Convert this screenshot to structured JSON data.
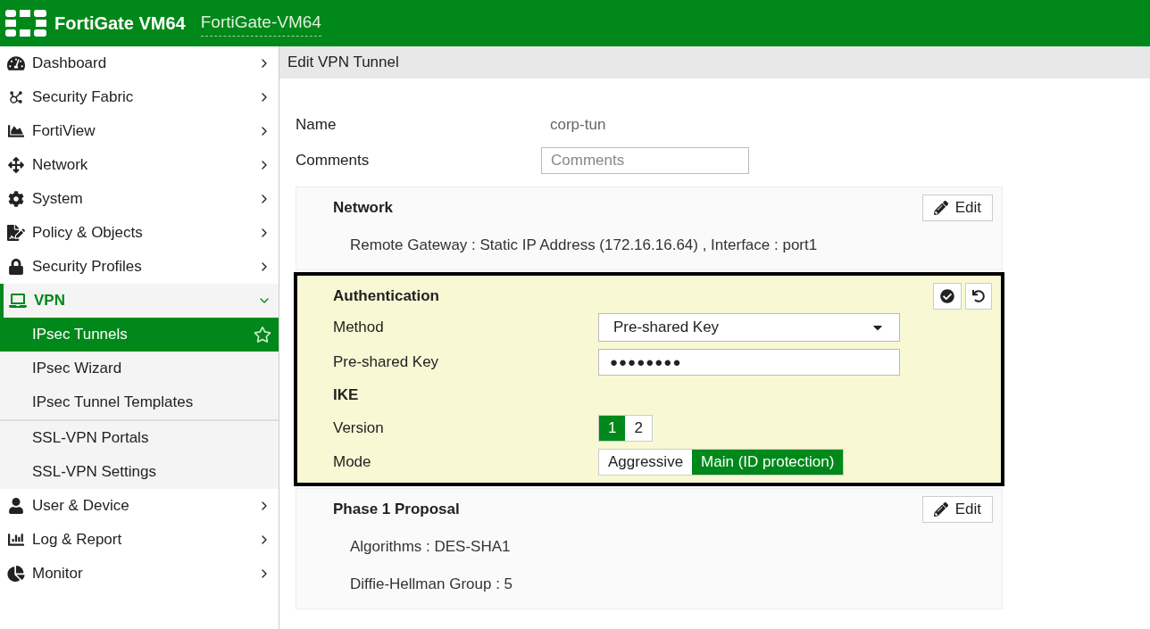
{
  "header": {
    "product": "FortiGate VM64",
    "hostname": "FortiGate-VM64"
  },
  "sidebar": {
    "items": [
      {
        "label": "Dashboard",
        "expanded": false,
        "selected": false
      },
      {
        "label": "Security Fabric",
        "expanded": false,
        "selected": false
      },
      {
        "label": "FortiView",
        "expanded": false,
        "selected": false
      },
      {
        "label": "Network",
        "expanded": false,
        "selected": false
      },
      {
        "label": "System",
        "expanded": false,
        "selected": false
      },
      {
        "label": "Policy & Objects",
        "expanded": false,
        "selected": false
      },
      {
        "label": "Security Profiles",
        "expanded": false,
        "selected": false
      },
      {
        "label": "VPN",
        "expanded": true,
        "selected": true,
        "child_groups": [
          [
            {
              "label": "IPsec Tunnels",
              "selected": true
            },
            {
              "label": "IPsec Wizard",
              "selected": false
            },
            {
              "label": "IPsec Tunnel Templates",
              "selected": false
            }
          ],
          [
            {
              "label": "SSL-VPN Portals",
              "selected": false
            },
            {
              "label": "SSL-VPN Settings",
              "selected": false
            }
          ]
        ]
      },
      {
        "label": "User & Device",
        "expanded": false,
        "selected": false
      },
      {
        "label": "Log & Report",
        "expanded": false,
        "selected": false
      },
      {
        "label": "Monitor",
        "expanded": false,
        "selected": false
      }
    ]
  },
  "page": {
    "title": "Edit VPN Tunnel",
    "fields": [
      {
        "label": "Name",
        "value": "corp-tun"
      },
      {
        "label": "Comments",
        "placeholder": "Comments"
      }
    ],
    "sections": [
      {
        "kind": "summary",
        "title": "Network",
        "button": "Edit",
        "lines": [
          "Remote Gateway : Static IP Address (172.16.16.64) , Interface : port1"
        ]
      },
      {
        "kind": "editing",
        "title": "Authentication",
        "rows": [
          {
            "kind": "select",
            "label": "Method",
            "value": "Pre-shared Key"
          },
          {
            "kind": "input",
            "label": "Pre-shared Key",
            "value": "●●●●●●●●"
          },
          {
            "kind": "heading",
            "label": "IKE"
          },
          {
            "kind": "toggle",
            "label": "Version",
            "options": [
              {
                "label": "1",
                "selected": true
              },
              {
                "label": "2",
                "selected": false
              }
            ]
          },
          {
            "kind": "toggle",
            "label": "Mode",
            "options": [
              {
                "label": "Aggressive",
                "selected": false
              },
              {
                "label": "Main (ID protection)",
                "selected": true
              }
            ]
          }
        ]
      },
      {
        "kind": "summary",
        "title": "Phase 1 Proposal",
        "button": "Edit",
        "lines": [
          "Algorithms : DES-SHA1",
          "Diffie-Hellman Group : 5"
        ]
      }
    ]
  }
}
